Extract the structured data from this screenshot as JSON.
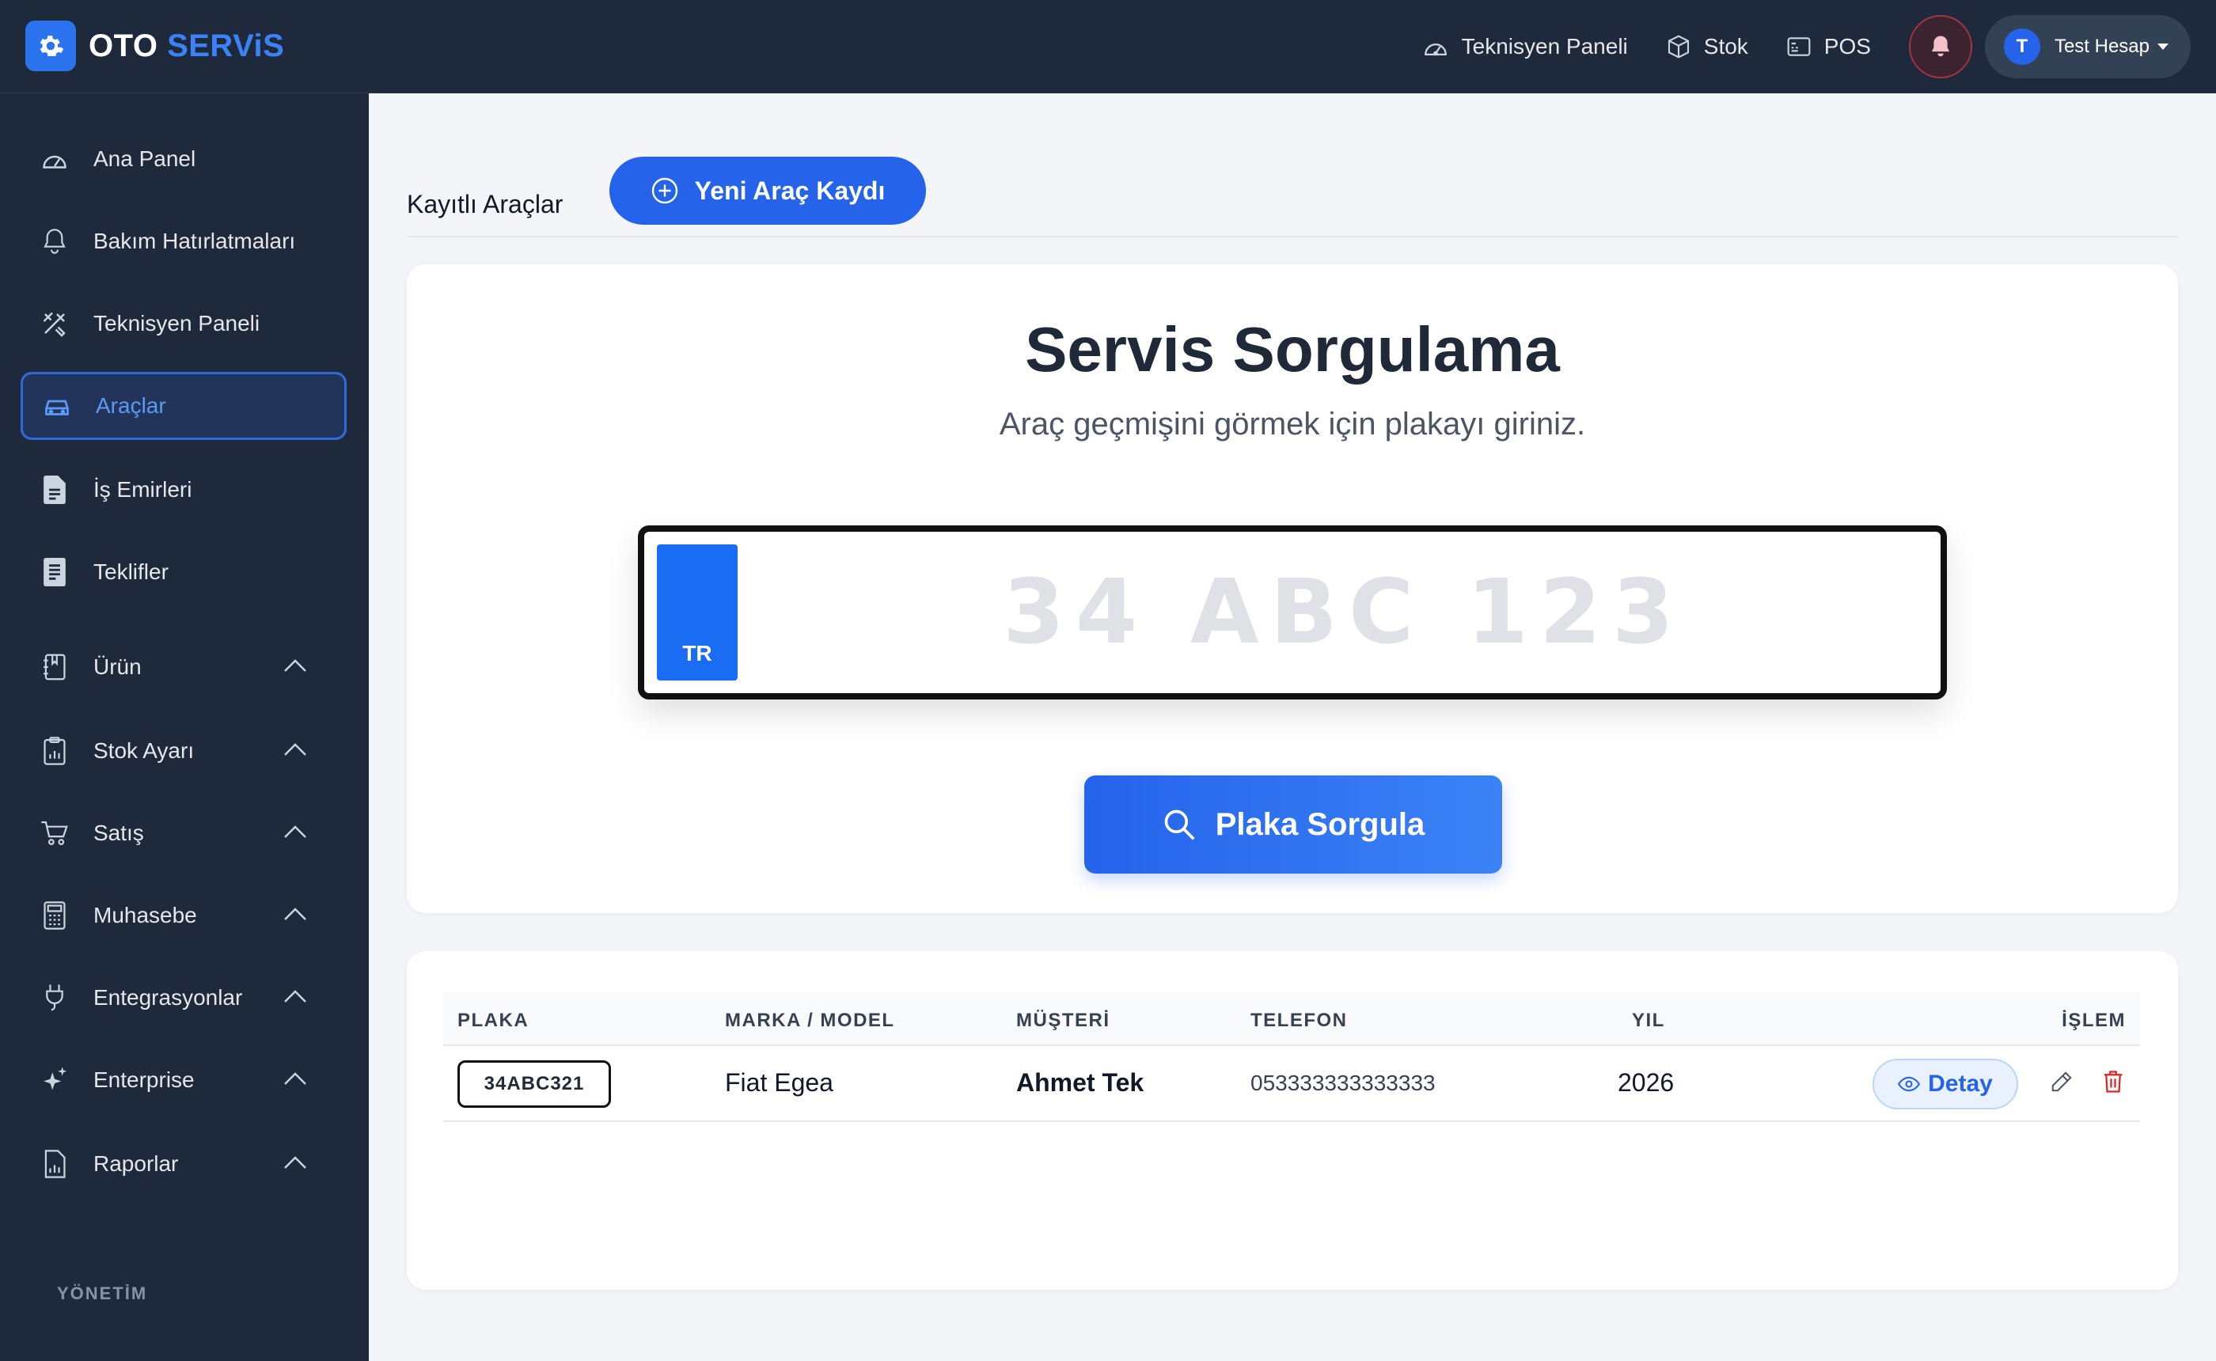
{
  "app": {
    "logo_part1": "OTO",
    "logo_part2": "SERViS"
  },
  "topnav": {
    "items": [
      {
        "label": "Teknisyen Paneli",
        "icon": "gauge-icon"
      },
      {
        "label": "Stok",
        "icon": "box-icon"
      },
      {
        "label": "POS",
        "icon": "pos-icon"
      }
    ],
    "user": {
      "initial": "T",
      "name": "Test Hesap"
    }
  },
  "sidebar": {
    "items": [
      {
        "label": "Ana Panel",
        "icon": "gauge-icon"
      },
      {
        "label": "Bakım Hatırlatmaları",
        "icon": "bell-icon"
      },
      {
        "label": "Teknisyen Paneli",
        "icon": "tools-icon"
      },
      {
        "label": "Araçlar",
        "icon": "car-icon",
        "active": true
      },
      {
        "label": "İş Emirleri",
        "icon": "document-icon"
      },
      {
        "label": "Teklifler",
        "icon": "sheet-icon"
      },
      {
        "label": "Ürün",
        "icon": "book-icon",
        "expandable": true
      },
      {
        "label": "Stok Ayarı",
        "icon": "clipboard-icon",
        "expandable": true
      },
      {
        "label": "Satış",
        "icon": "cart-icon",
        "expandable": true
      },
      {
        "label": "Muhasebe",
        "icon": "calculator-icon",
        "expandable": true
      },
      {
        "label": "Entegrasyonlar",
        "icon": "plug-icon",
        "expandable": true
      },
      {
        "label": "Enterprise",
        "icon": "sparkle-icon",
        "expandable": true
      },
      {
        "label": "Raporlar",
        "icon": "report-icon",
        "expandable": true
      }
    ],
    "section_label": "YÖNETİM"
  },
  "page": {
    "title": "Kayıtlı Araçlar",
    "new_button": "Yeni Araç Kaydı"
  },
  "search": {
    "title": "Servis Sorgulama",
    "subtitle": "Araç geçmişini görmek için plakayı giriniz.",
    "country_code": "TR",
    "plate_value": "",
    "plate_placeholder": "34 ABC 123",
    "button": "Plaka Sorgula"
  },
  "table": {
    "columns": [
      "PLAKA",
      "MARKA / MODEL",
      "MÜŞTERİ",
      "TELEFON",
      "YIL",
      "İŞLEM"
    ],
    "rows": [
      {
        "plate": "34ABC321",
        "model": "Fiat Egea",
        "customer": "Ahmet Tek",
        "phone": "053333333333333",
        "year": "2026",
        "detail": "Detay"
      }
    ]
  },
  "colors": {
    "primary": "#2563eb",
    "sidebar_bg": "#1e293b",
    "danger": "#dc2626",
    "page_bg": "#f3f5f9"
  }
}
